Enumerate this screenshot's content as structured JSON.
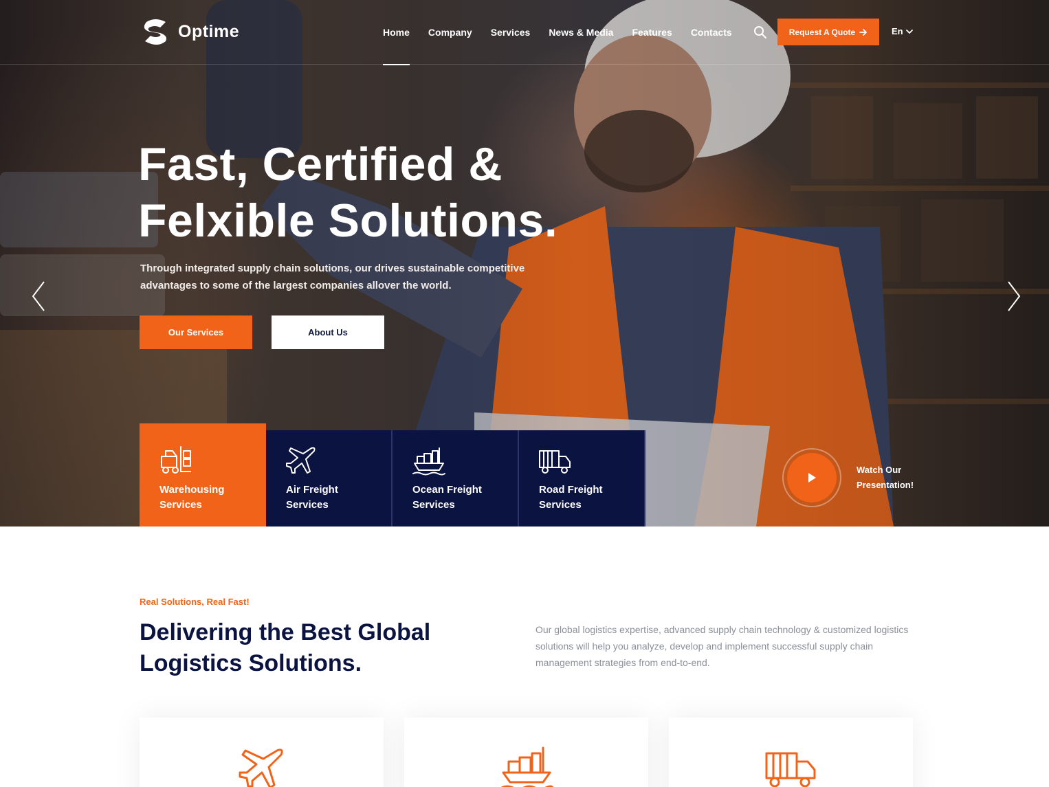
{
  "brand": {
    "name": "Optime",
    "accent_color": "#f06318",
    "navy_color": "#0b1340"
  },
  "nav": {
    "items": [
      {
        "label": "Home",
        "active": true
      },
      {
        "label": "Company",
        "active": false
      },
      {
        "label": "Services",
        "active": false
      },
      {
        "label": "News & Media",
        "active": false
      },
      {
        "label": "Features",
        "active": false
      },
      {
        "label": "Contacts",
        "active": false
      }
    ],
    "search_icon": "search-icon",
    "quote_button": "Request A Quote",
    "language": "En"
  },
  "hero": {
    "title_line1": "Fast, Certified &",
    "title_line2": "Felxible Solutions.",
    "subtitle": "Through integrated supply chain solutions, our drives sustainable competitive advantages to some of the largest companies allover the world.",
    "primary_button": "Our Services",
    "secondary_button": "About Us",
    "tiles": [
      {
        "label": "Warehousing\nServices",
        "icon": "forklift-icon",
        "active": true
      },
      {
        "label": "Air Freight\nServices",
        "icon": "airplane-icon",
        "active": false
      },
      {
        "label": "Ocean Freight\nServices",
        "icon": "ship-icon",
        "active": false
      },
      {
        "label": "Road Freight\nServices",
        "icon": "truck-icon",
        "active": false
      }
    ],
    "watch_label": "Watch Our Presentation!"
  },
  "about": {
    "kicker": "Real Solutions, Real Fast!",
    "title": "Delivering the Best Global Logistics Solutions.",
    "description": "Our global logistics expertise, advanced supply chain technology & customized logistics solutions will help you analyze, develop and implement successful supply chain management strategies from end-to-end.",
    "cards": [
      {
        "icon": "airplane-icon"
      },
      {
        "icon": "ship-icon"
      },
      {
        "icon": "truck-icon"
      }
    ]
  }
}
